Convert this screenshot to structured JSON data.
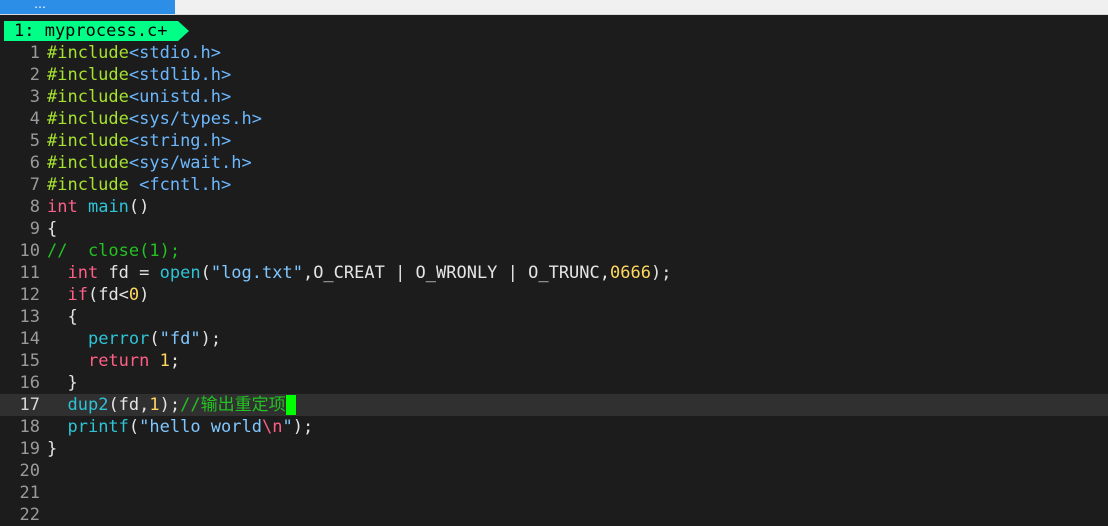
{
  "window": {
    "top_tab_label": "…"
  },
  "tabline": {
    "active_tab": "1: myprocess.c+"
  },
  "editor": {
    "lines": [
      {
        "num": "1",
        "tokens": [
          {
            "c": "pre",
            "t": "#include"
          },
          {
            "c": "inc",
            "t": "<stdio.h>"
          }
        ]
      },
      {
        "num": "2",
        "tokens": [
          {
            "c": "pre",
            "t": "#include"
          },
          {
            "c": "inc",
            "t": "<stdlib.h>"
          }
        ]
      },
      {
        "num": "3",
        "tokens": [
          {
            "c": "pre",
            "t": "#include"
          },
          {
            "c": "inc",
            "t": "<unistd.h>"
          }
        ]
      },
      {
        "num": "4",
        "tokens": [
          {
            "c": "pre",
            "t": "#include"
          },
          {
            "c": "inc",
            "t": "<sys/types.h>"
          }
        ]
      },
      {
        "num": "5",
        "tokens": [
          {
            "c": "pre",
            "t": "#include"
          },
          {
            "c": "inc",
            "t": "<string.h>"
          }
        ]
      },
      {
        "num": "6",
        "tokens": [
          {
            "c": "pre",
            "t": "#include"
          },
          {
            "c": "inc",
            "t": "<sys/wait.h>"
          }
        ]
      },
      {
        "num": "7",
        "tokens": [
          {
            "c": "pre",
            "t": "#include "
          },
          {
            "c": "inc",
            "t": "<fcntl.h>"
          }
        ]
      },
      {
        "num": "8",
        "tokens": [
          {
            "c": "type",
            "t": "int"
          },
          {
            "c": "",
            "t": " "
          },
          {
            "c": "fn",
            "t": "main"
          },
          {
            "c": "",
            "t": "()"
          }
        ]
      },
      {
        "num": "9",
        "tokens": [
          {
            "c": "",
            "t": "{"
          }
        ]
      },
      {
        "num": "10",
        "tokens": [
          {
            "c": "cmt",
            "t": "//  close(1);"
          }
        ]
      },
      {
        "num": "11",
        "tokens": [
          {
            "c": "",
            "t": "  "
          },
          {
            "c": "type",
            "t": "int"
          },
          {
            "c": "",
            "t": " fd = "
          },
          {
            "c": "fn",
            "t": "open"
          },
          {
            "c": "",
            "t": "("
          },
          {
            "c": "str",
            "t": "\"log.txt\""
          },
          {
            "c": "",
            "t": ",O_CREAT | O_WRONLY | O_TRUNC,"
          },
          {
            "c": "num",
            "t": "0666"
          },
          {
            "c": "",
            "t": ");"
          }
        ]
      },
      {
        "num": "12",
        "tokens": [
          {
            "c": "",
            "t": "  "
          },
          {
            "c": "kw",
            "t": "if"
          },
          {
            "c": "",
            "t": "(fd<"
          },
          {
            "c": "num",
            "t": "0"
          },
          {
            "c": "",
            "t": ")"
          }
        ]
      },
      {
        "num": "13",
        "tokens": [
          {
            "c": "",
            "t": "  {"
          }
        ]
      },
      {
        "num": "14",
        "tokens": [
          {
            "c": "",
            "t": "    "
          },
          {
            "c": "fn",
            "t": "perror"
          },
          {
            "c": "",
            "t": "("
          },
          {
            "c": "str",
            "t": "\"fd\""
          },
          {
            "c": "",
            "t": ");"
          }
        ]
      },
      {
        "num": "15",
        "tokens": [
          {
            "c": "",
            "t": "    "
          },
          {
            "c": "kw",
            "t": "return"
          },
          {
            "c": "",
            "t": " "
          },
          {
            "c": "num",
            "t": "1"
          },
          {
            "c": "",
            "t": ";"
          }
        ]
      },
      {
        "num": "16",
        "tokens": [
          {
            "c": "",
            "t": "  }"
          }
        ]
      },
      {
        "num": "17",
        "current": true,
        "tokens": [
          {
            "c": "",
            "t": "  "
          },
          {
            "c": "fn",
            "t": "dup2"
          },
          {
            "c": "",
            "t": "(fd,"
          },
          {
            "c": "num",
            "t": "1"
          },
          {
            "c": "",
            "t": ");"
          },
          {
            "c": "cmt",
            "t": "//"
          },
          {
            "c": "cmt-cn",
            "t": "输出重定项"
          }
        ]
      },
      {
        "num": "18",
        "tokens": [
          {
            "c": "",
            "t": "  "
          },
          {
            "c": "fn",
            "t": "printf"
          },
          {
            "c": "",
            "t": "("
          },
          {
            "c": "str",
            "t": "\"hello world"
          },
          {
            "c": "esc",
            "t": "\\n"
          },
          {
            "c": "str",
            "t": "\""
          },
          {
            "c": "",
            "t": ");"
          }
        ]
      },
      {
        "num": "19",
        "tokens": [
          {
            "c": "",
            "t": "}"
          }
        ]
      },
      {
        "num": "20",
        "tokens": []
      },
      {
        "num": "21",
        "tokens": []
      },
      {
        "num": "22",
        "tokens": []
      }
    ]
  },
  "colors": {
    "background": "#1c1c1c",
    "tab_active": "#00ff87",
    "cursor": "#00ff00",
    "cursorline": "#303030"
  }
}
